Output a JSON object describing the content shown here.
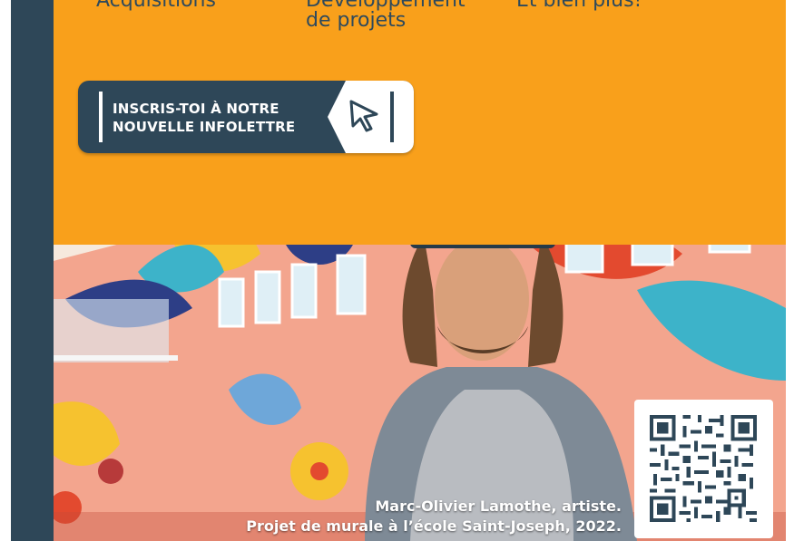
{
  "top_menu": {
    "items": [
      {
        "label_1": "Acquisitions",
        "label_2": ""
      },
      {
        "label_1": "Développement",
        "label_2": "de projets"
      },
      {
        "label_1": "Et bien plus!",
        "label_2": ""
      }
    ]
  },
  "newsletter_cta": {
    "line_1": "INSCRIS-TOI À NOTRE",
    "line_2": "NOUVELLE INFOLETTRE",
    "icon": "cursor-arrow-icon"
  },
  "caption": {
    "line_1": "Marc-Olivier Lamothe, artiste.",
    "line_2": "Projet de murale à l’école Saint-Joseph, 2022."
  },
  "qr_code": {
    "icon": "qr-code-icon"
  },
  "colors": {
    "navy": "#2e4758",
    "orange": "#f9a01b",
    "white": "#ffffff"
  }
}
